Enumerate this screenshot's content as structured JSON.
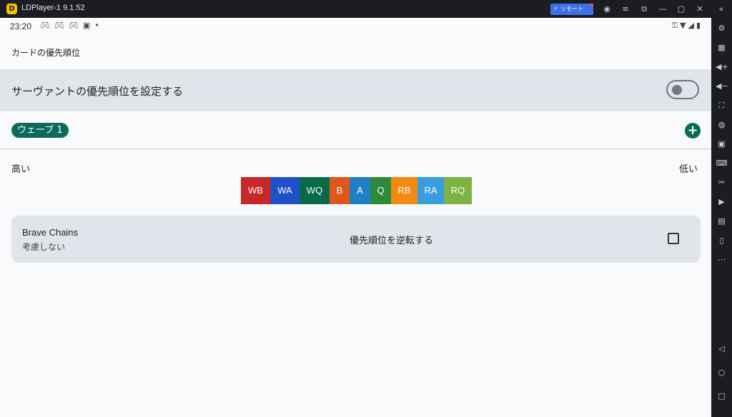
{
  "window": {
    "title": "LDPlayer-1 9.1.52",
    "logo_glyph": "D",
    "remote_button": "リモート",
    "accent_color": "#3d6fe8"
  },
  "titlebar_icons": [
    "account-icon",
    "menu-icon",
    "popout-icon",
    "minimize-icon",
    "maximize-icon",
    "close-icon",
    "collapse-sidebar-icon"
  ],
  "statusbar": {
    "time": "23:20",
    "left_icons": [
      "gamepad-icon",
      "gamepad-icon",
      "gamepad-icon",
      "font-icon",
      "dot-icon"
    ],
    "right_icons": [
      "key-icon",
      "wifi-icon",
      "signal-icon",
      "battery-icon"
    ]
  },
  "page": {
    "section_title": "カードの優先順位",
    "servant_priority": {
      "label": "サーヴァントの優先順位を設定する",
      "enabled": false
    },
    "wave": {
      "label": "ウェーブ 1",
      "add_icon": "plus-icon",
      "color": "#0b6b58"
    },
    "high_label": "高い",
    "low_label": "低い",
    "cards": [
      {
        "label": "WB",
        "color": "#c62828"
      },
      {
        "label": "WA",
        "color": "#1e50c8"
      },
      {
        "label": "WQ",
        "color": "#0a6a48"
      },
      {
        "label": "B",
        "color": "#e2561a"
      },
      {
        "label": "A",
        "color": "#1f7fc4"
      },
      {
        "label": "Q",
        "color": "#2e8a3a"
      },
      {
        "label": "RB",
        "color": "#f58a12"
      },
      {
        "label": "RA",
        "color": "#3a9de0"
      },
      {
        "label": "RQ",
        "color": "#7cb342"
      }
    ],
    "brave_chains": {
      "title": "Brave Chains",
      "value": "考慮しない",
      "reverse_label": "優先順位を逆転する",
      "reverse_checked": false
    }
  },
  "sidebar_icons": [
    "settings-icon",
    "keyboard-mapping-icon",
    "volume-up-icon",
    "volume-down-icon",
    "screenshot-icon",
    "location-icon",
    "apk-install-icon",
    "keyboard-icon",
    "scissors-icon",
    "record-icon",
    "sync-icon",
    "rotate-icon",
    "more-icon",
    "back-icon",
    "home-icon",
    "recents-icon"
  ]
}
